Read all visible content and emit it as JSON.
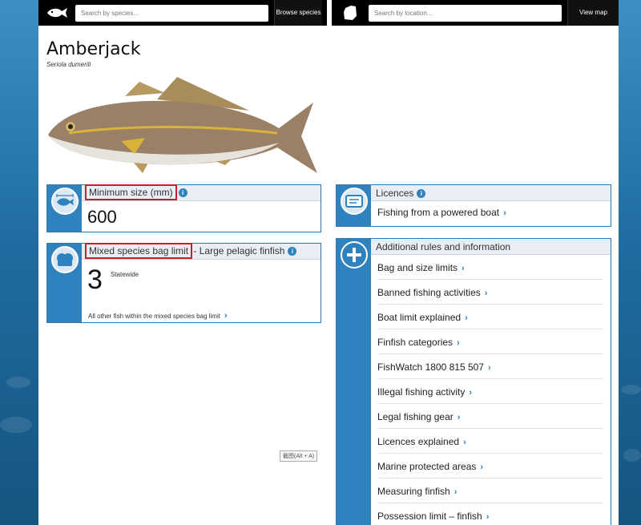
{
  "header": {
    "species_search_placeholder": "Search by species...",
    "browse_species_label": "Browse species",
    "location_search_placeholder": "Search by location...",
    "view_map_label": "View map"
  },
  "species": {
    "name": "Amberjack",
    "scientific_name": "Seriola dumerili"
  },
  "min_size": {
    "heading": "Minimum size (mm)",
    "value": "600"
  },
  "bag_limit": {
    "heading": "Mixed species bag limit",
    "heading_suffix": "- Large pelagic finfish",
    "value": "3",
    "scope": "Statewide",
    "footer_link": "All other fish within the mixed species bag limit"
  },
  "licences": {
    "heading": "Licences",
    "link": "Fishing from a powered boat"
  },
  "additional": {
    "heading": "Additional rules and information",
    "links": [
      "Bag and size limits",
      "Banned fishing activities",
      "Boat limit explained",
      "Finfish categories",
      "FishWatch 1800 815 507",
      "Illegal fishing activity",
      "Legal fishing gear",
      "Licences explained",
      "Marine protected areas",
      "Measuring finfish",
      "Possession limit – finfish"
    ]
  },
  "ime_hint": "截图(Alt + A)",
  "colors": {
    "accent": "#2f82bd",
    "highlight": "#c8202b",
    "header_bg": "#000000"
  }
}
